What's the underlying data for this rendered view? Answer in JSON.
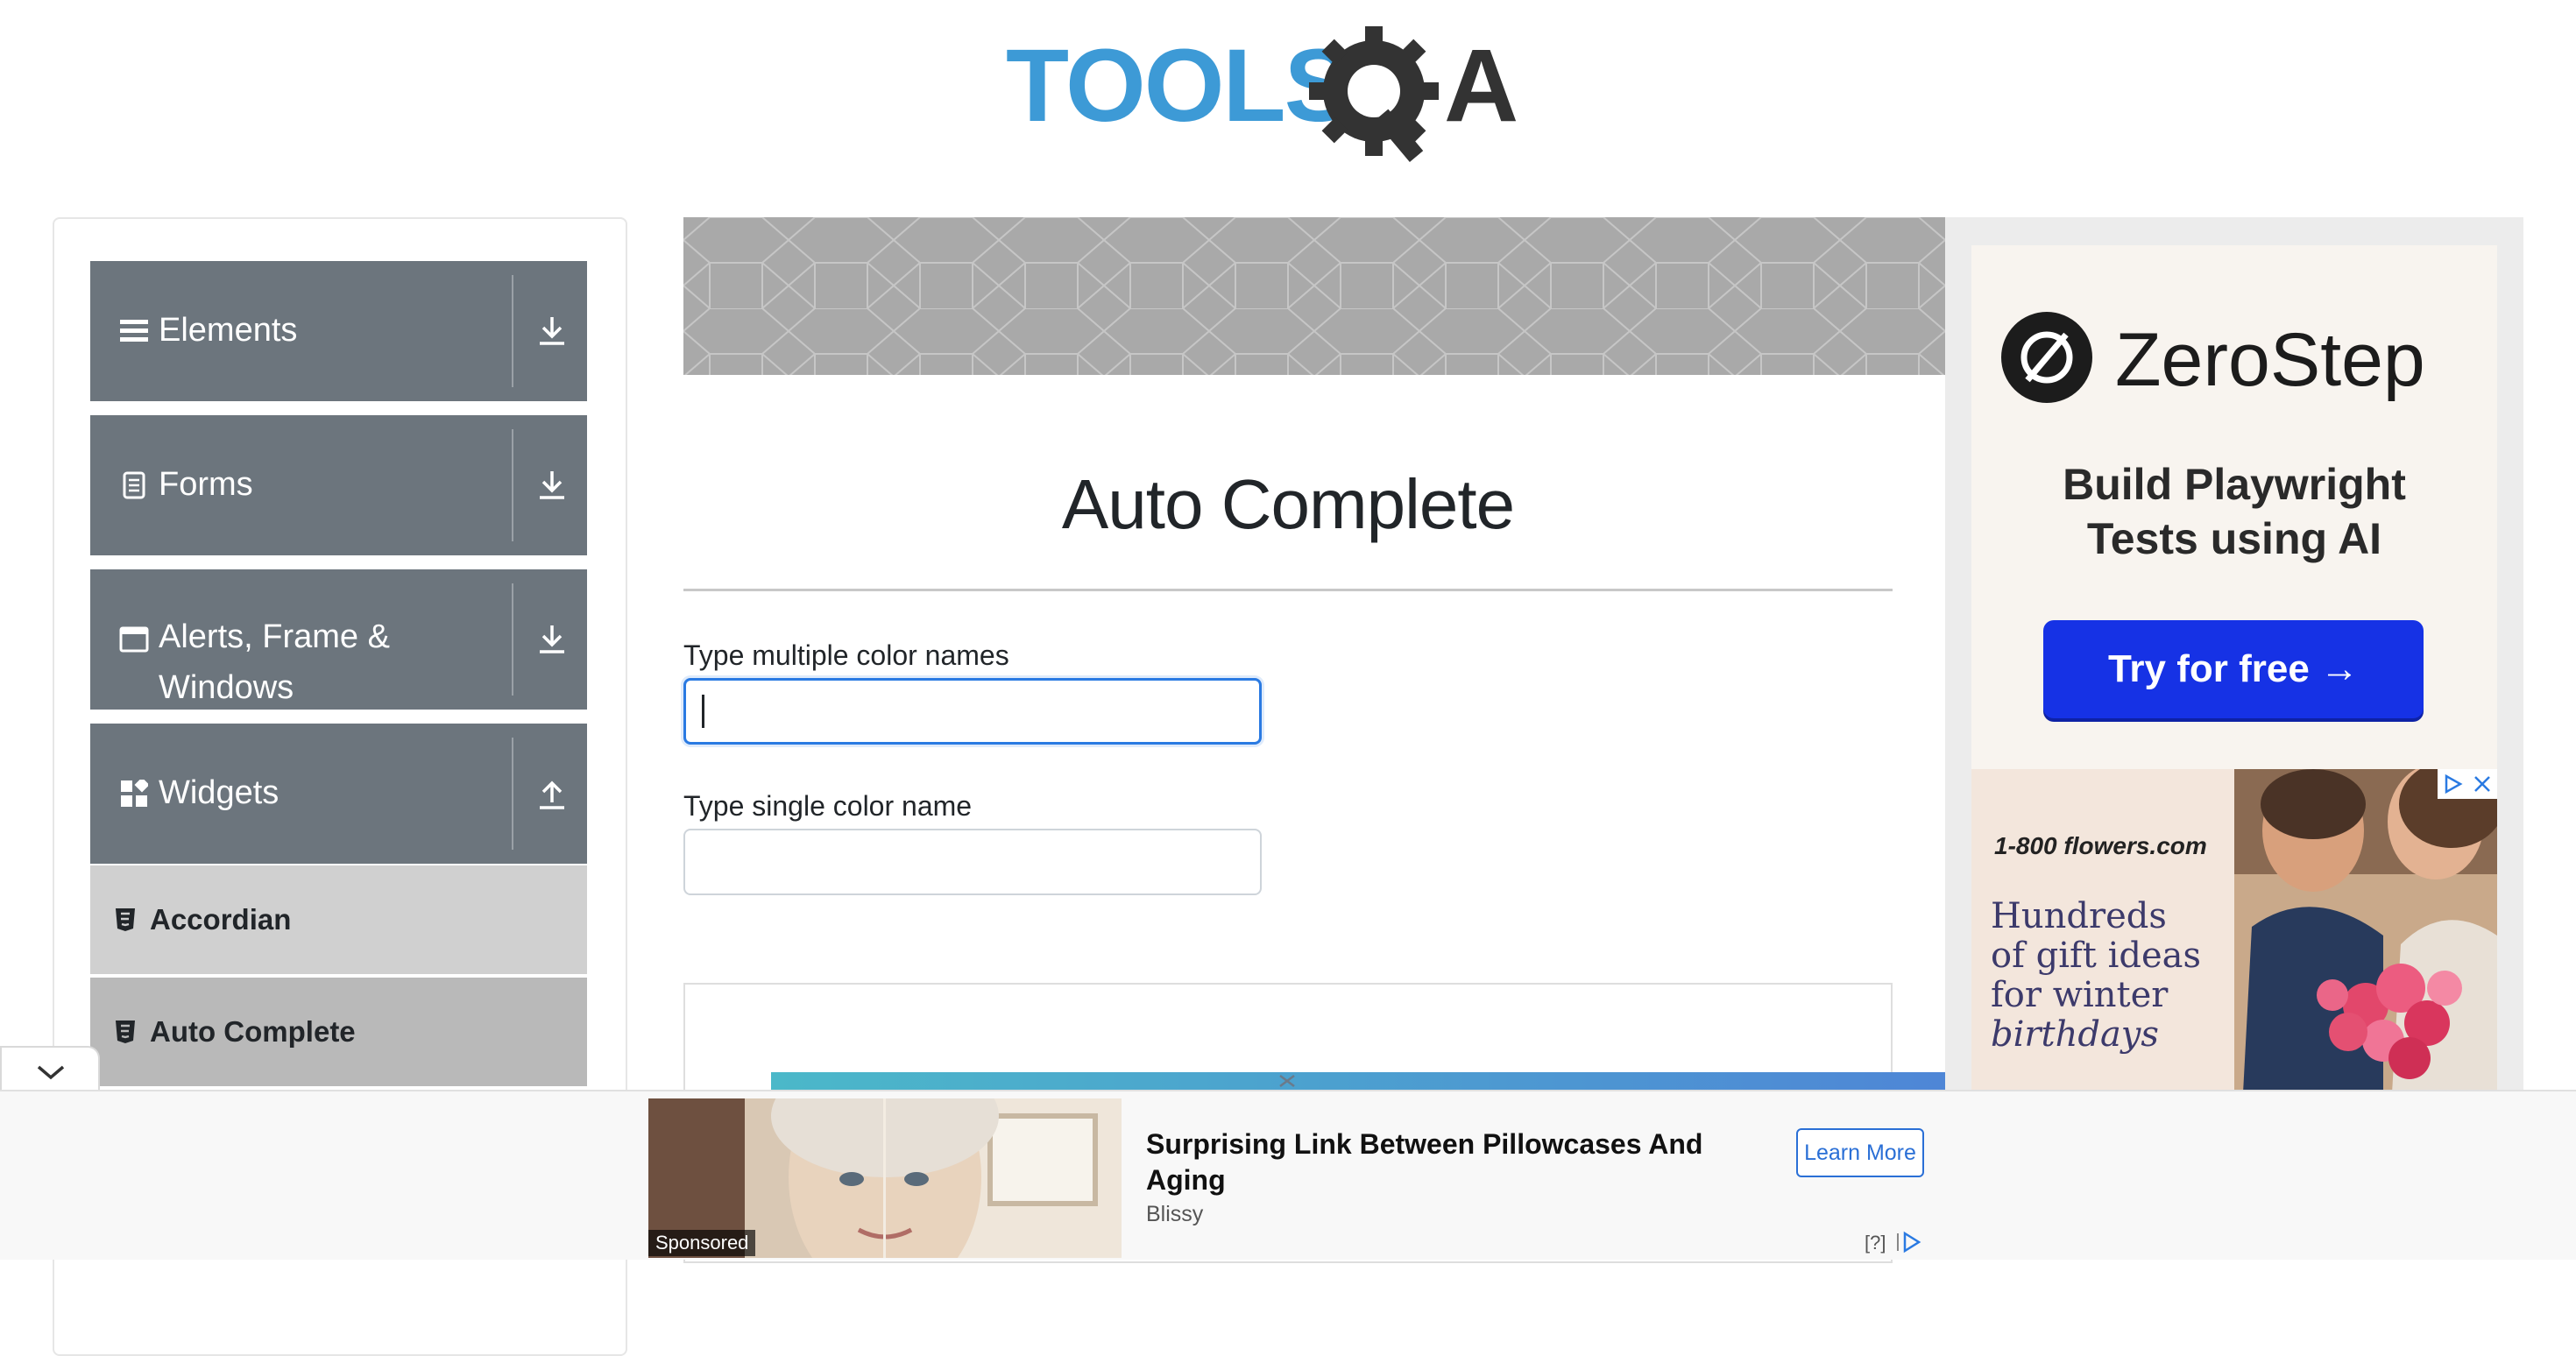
{
  "logo": {
    "text_left": "TOOLS",
    "text_right": "A"
  },
  "sidebar": {
    "groups": [
      {
        "label": "Elements",
        "icon": "hamburger-icon",
        "toggle": "download-icon"
      },
      {
        "label": "Forms",
        "icon": "document-icon",
        "toggle": "download-icon"
      },
      {
        "label": "Alerts, Frame &",
        "label_line2": "Windows",
        "icon": "window-icon",
        "toggle": "download-icon"
      },
      {
        "label": "Widgets",
        "icon": "widgets-icon",
        "toggle": "upload-icon"
      }
    ],
    "items": [
      {
        "label": "Accordian",
        "icon": "html5-icon"
      },
      {
        "label": "Auto Complete",
        "icon": "html5-icon"
      }
    ]
  },
  "main": {
    "title": "Auto Complete",
    "multiple_label": "Type multiple color names",
    "multiple_value": "",
    "single_label": "Type single color name",
    "single_value": ""
  },
  "right_ad": {
    "zerostep_name": "ZeroStep",
    "tagline_line1": "Build Playwright",
    "tagline_line2": "Tests using AI",
    "cta": "Try for free →",
    "flowers_brand": "1-800 flowers.com",
    "flowers_line1": "Hundreds",
    "flowers_line2": "of gift ideas",
    "flowers_line3": "for winter",
    "flowers_line4": "birthdays"
  },
  "bottom_ad": {
    "sponsored": "Sponsored",
    "headline": "Surprising Link Between Pillowcases And Aging",
    "brand": "Blissy",
    "cta": "Learn More",
    "adchoices": "[?]"
  },
  "colors": {
    "sidebar_header": "#6c757d",
    "accordian_bg": "#d0d0d0",
    "active_item_bg": "#b9b9b9",
    "logo_blue": "#3d9ad6",
    "logo_dark": "#333333",
    "focus_blue": "#2a7ae2",
    "cta_blue": "#1632e5"
  }
}
